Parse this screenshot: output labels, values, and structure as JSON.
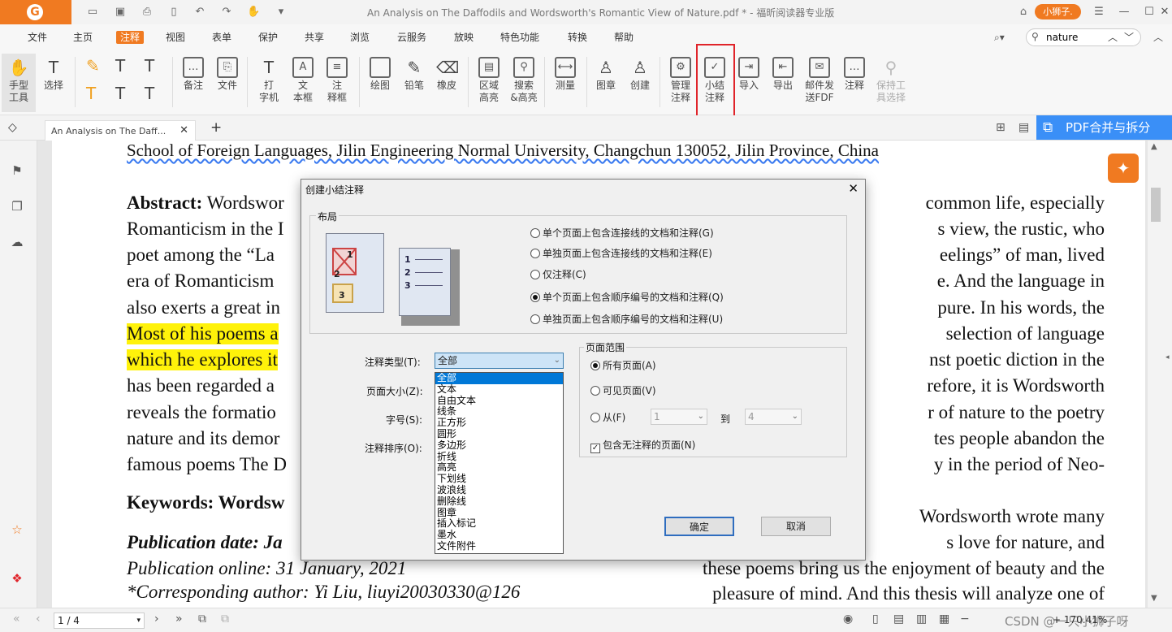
{
  "window": {
    "title": "An Analysis on The Daffodils and Wordsworth's Romantic View of Nature.pdf * - 福昕阅读器专业版",
    "user_badge": "小狮子."
  },
  "menu": {
    "items": [
      "文件",
      "主页",
      "注释",
      "视图",
      "表单",
      "保护",
      "共享",
      "浏览",
      "云服务",
      "放映",
      "特色功能",
      "转换",
      "帮助"
    ],
    "active": "注释"
  },
  "search": {
    "value": "nature"
  },
  "ribbon": {
    "hand": "手型\n工具",
    "select": "选择",
    "note": "备注",
    "file": "文件",
    "typewriter": "打\n字机",
    "textbox": "文\n本框",
    "callout": "注\n释框",
    "drawing": "绘图",
    "pencil": "铅笔",
    "eraser": "橡皮",
    "area_highlight": "区域\n高亮",
    "search_highlight": "搜索\n&高亮",
    "measure": "测量",
    "stamp": "图章",
    "create": "创建",
    "manage": "管理\n注释",
    "summarize": "小结\n注释",
    "import": "导入",
    "export": "导出",
    "email_fdf": "邮件发\n送FDF",
    "comment": "注释",
    "keep_tool": "保持工\n具选择"
  },
  "tab": {
    "doc_title": "An Analysis on The Daff..."
  },
  "pdf_merge": "PDF合并与拆分",
  "document": {
    "affiliation": "School of Foreign Languages, Jilin Engineering Normal University, Changchun 130052, Jilin Province, China",
    "left": [
      "Abstract: Wordswor",
      "Romanticism in the I",
      "poet among the “La",
      "era of Romanticism",
      "also exerts a great in",
      "Most of his poems a",
      "which he explores it",
      "has been regarded a",
      "reveals the formatio",
      "nature and its demor",
      "famous poems The D"
    ],
    "right": [
      "common life, especially",
      "s view, the rustic, who",
      "eelings” of man, lived",
      "e. And the language in",
      "pure. In his words, the",
      "selection of language",
      "nst poetic diction in the",
      "refore, it is Wordsworth",
      "r of nature to the poetry",
      "tes people abandon the",
      "y in the period of Neo-"
    ],
    "keywords": "Keywords: Wordsw",
    "pub_date": "Publication date: Ja",
    "pub_online": "Publication online: 31 January, 2021",
    "corresponding": "*Corresponding author: Yi Liu, liuyi20030330@126",
    "right_lower": [
      "Wordsworth wrote many",
      "s love for nature, and",
      "these poems bring us the enjoyment of beauty and the",
      "pleasure of mind. And this thesis will analyze one of"
    ]
  },
  "dialog": {
    "title": "创建小结注释",
    "layout_label": "布局",
    "layout_options": [
      "单个页面上包含连接线的文档和注释(G)",
      "单独页面上包含连接线的文档和注释(E)",
      "仅注释(C)",
      "单个页面上包含顺序编号的文档和注释(Q)",
      "单独页面上包含顺序编号的文档和注释(U)"
    ],
    "layout_selected": 3,
    "type_label": "注释类型(T):",
    "type_value": "全部",
    "page_size_label": "页面大小(Z):",
    "font_size_label": "字号(S):",
    "sort_label": "注释排序(O):",
    "type_options": [
      "全部",
      "文本",
      "自由文本",
      "线条",
      "正方形",
      "圆形",
      "多边形",
      "折线",
      "高亮",
      "下划线",
      "波浪线",
      "删除线",
      "图章",
      "插入标记",
      "墨水",
      "文件附件"
    ],
    "page_range_label": "页面范围",
    "all_pages": "所有页面(A)",
    "visible_pages": "可见页面(V)",
    "from_label": "从(F)",
    "from_value": "1",
    "to_label": "到",
    "to_value": "4",
    "include_no_annot": "包含无注释的页面(N)",
    "ok": "确定",
    "cancel": "取消",
    "illustration_numbers": [
      "1",
      "2",
      "3",
      "1",
      "2",
      "3"
    ]
  },
  "status": {
    "page": "1 / 4",
    "zoom": "+ 170.41%",
    "watermark": "CSDN @一只小狮子呀"
  },
  "colors": {
    "brand": "#f07a21",
    "highlight": "#fff20a",
    "red_box": "#e0242a",
    "merge_button": "#3a8ff7"
  }
}
